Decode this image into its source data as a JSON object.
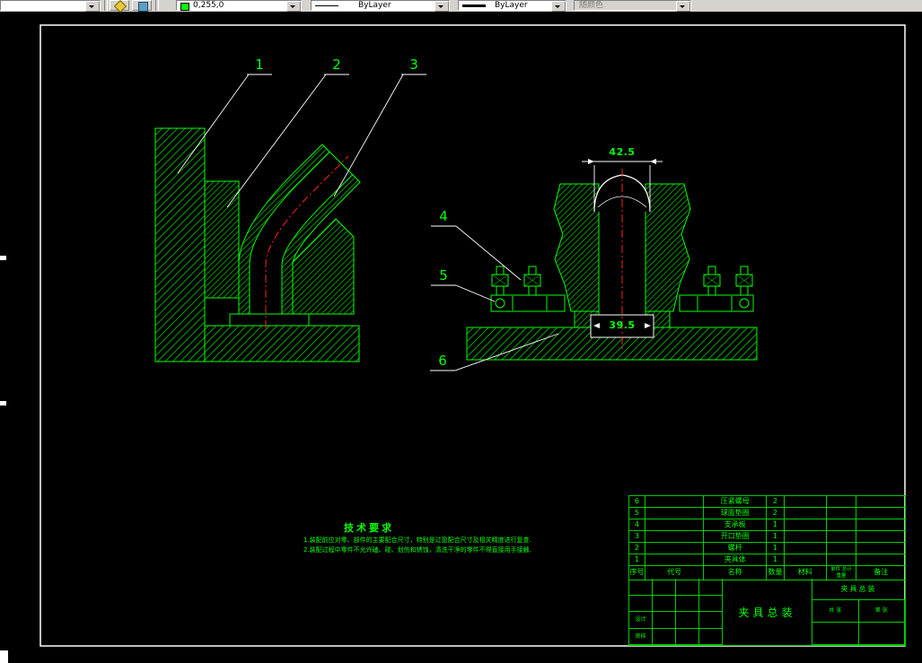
{
  "toolbar": {
    "color_value": "0,255,0",
    "linetype_value": "ByLayer",
    "lineweight_value": "ByLayer",
    "plot_style_value": "随颜色"
  },
  "drawing": {
    "balloons": [
      "1",
      "2",
      "3",
      "4",
      "5",
      "6"
    ],
    "dimensions": {
      "top_width": "42.5",
      "bottom_width": "39.5"
    },
    "tech_req": {
      "title": "技术要求",
      "lines": [
        "1.装配前应对零、部件的主要配合尺寸，特别是过盈配合尺寸及相关精度进行复查.",
        "2.装配过程中零件不允许磕、碰、划伤和锈蚀，清洗干净的零件不得直接用手接触."
      ]
    },
    "parts_table": {
      "headers": {
        "no": "序号",
        "code": "代号",
        "name": "名称",
        "qty": "数量",
        "material": "材料",
        "weight_top": "单件 总计",
        "weight_bottom": "重量",
        "remark": "备注"
      },
      "rows": [
        {
          "no": "6",
          "code": "",
          "name": "压紧螺母",
          "qty": "2",
          "material": "",
          "remark": ""
        },
        {
          "no": "5",
          "code": "",
          "name": "球面垫圈",
          "qty": "2",
          "material": "",
          "remark": ""
        },
        {
          "no": "4",
          "code": "",
          "name": "支承板",
          "qty": "1",
          "material": "",
          "remark": ""
        },
        {
          "no": "3",
          "code": "",
          "name": "开口垫圈",
          "qty": "1",
          "material": "",
          "remark": ""
        },
        {
          "no": "2",
          "code": "",
          "name": "螺杆",
          "qty": "1",
          "material": "",
          "remark": ""
        },
        {
          "no": "1",
          "code": "",
          "name": "夹具体",
          "qty": "1",
          "material": "",
          "remark": ""
        }
      ]
    },
    "title_block": {
      "main_title": "夹具总装",
      "sub_title": "夹具总装",
      "left_cells": [
        [
          "",
          "",
          "",
          ""
        ],
        [
          "",
          "",
          "",
          ""
        ],
        [
          "设计",
          "",
          "",
          ""
        ],
        [
          "审核",
          "",
          "",
          ""
        ]
      ],
      "right_cells": {
        "r1c1": "共 张",
        "r1c2": "第 张",
        "r2c1": "",
        "r2c2": ""
      }
    }
  }
}
